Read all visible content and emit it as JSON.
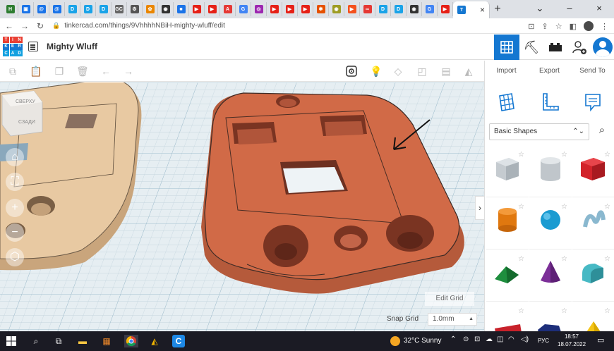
{
  "browser": {
    "tabs": [
      {
        "icon": "hp-icon",
        "color": "#2e7d32",
        "glyph": "H"
      },
      {
        "icon": "stats-icon",
        "color": "#1a73e8",
        "glyph": "▣"
      },
      {
        "icon": "at-icon",
        "color": "#1a73e8",
        "glyph": "@"
      },
      {
        "icon": "at-icon",
        "color": "#1a73e8",
        "glyph": "@"
      },
      {
        "icon": "docs-icon",
        "color": "#1aa3e8",
        "glyph": "D"
      },
      {
        "icon": "docs-icon",
        "color": "#1aa3e8",
        "glyph": "D"
      },
      {
        "icon": "docs-icon",
        "color": "#1aa3e8",
        "glyph": "D"
      },
      {
        "icon": "gc-icon",
        "color": "#666666",
        "glyph": "GC"
      },
      {
        "icon": "gear-icon",
        "color": "#555555",
        "glyph": "⚙"
      },
      {
        "icon": "puzzle-icon",
        "color": "#ea8600",
        "glyph": "✿"
      },
      {
        "icon": "github-icon",
        "color": "#333333",
        "glyph": "◉"
      },
      {
        "icon": "bookmark-icon",
        "color": "#1a73e8",
        "glyph": "■"
      },
      {
        "icon": "youtube-icon",
        "color": "#e62117",
        "glyph": "▶"
      },
      {
        "icon": "youtube-icon",
        "color": "#e62117",
        "glyph": "▶"
      },
      {
        "icon": "a-icon",
        "color": "#e53935",
        "glyph": "A"
      },
      {
        "icon": "google-icon",
        "color": "#4285f4",
        "glyph": "G"
      },
      {
        "icon": "lens-icon",
        "color": "#9c27b0",
        "glyph": "◎"
      },
      {
        "icon": "youtube-icon",
        "color": "#e62117",
        "glyph": "▶"
      },
      {
        "icon": "youtube-icon",
        "color": "#e62117",
        "glyph": "▶"
      },
      {
        "icon": "youtube-icon",
        "color": "#e62117",
        "glyph": "▶"
      },
      {
        "icon": "flower-icon",
        "color": "#e65100",
        "glyph": "✾"
      },
      {
        "icon": "eye-icon",
        "color": "#9e9d24",
        "glyph": "◉"
      },
      {
        "icon": "slides-icon",
        "color": "#f4511e",
        "glyph": "▶"
      },
      {
        "icon": "link-icon",
        "color": "#e53935",
        "glyph": "∞"
      },
      {
        "icon": "docs-icon",
        "color": "#1aa3e8",
        "glyph": "D"
      },
      {
        "icon": "docs-icon",
        "color": "#1aa3e8",
        "glyph": "D"
      },
      {
        "icon": "github-icon",
        "color": "#333333",
        "glyph": "◉"
      },
      {
        "icon": "google-icon",
        "color": "#4285f4",
        "glyph": "G"
      },
      {
        "icon": "youtube-icon",
        "color": "#e62117",
        "glyph": "▶"
      }
    ],
    "active_tab_close": "×",
    "new_tab": "+",
    "window_controls": [
      "⌄",
      "–",
      "×"
    ],
    "url": "tinkercad.com/things/9VhhhhNBiH-mighty-wluff/edit"
  },
  "app": {
    "logo_letters": [
      "T",
      "I",
      "N",
      "K",
      "E",
      "R",
      "C",
      "A",
      "D"
    ],
    "logo_colors": [
      "#e93f33",
      "#e93f33",
      "#e93f33",
      "#1477d1",
      "#1477d1",
      "#1477d1",
      "#13a1e0",
      "#13a1e0",
      "#13a1e0"
    ],
    "design_name": "Mighty Wluff",
    "accent": "#1477d1"
  },
  "panel": {
    "actions": [
      "Import",
      "Export",
      "Send To"
    ],
    "category": "Basic Shapes"
  },
  "viewport": {
    "edit_grid": "Edit Grid",
    "snap_label": "Snap Grid",
    "snap_value": "1.0mm",
    "viewcube_top": "СВЕРХУ",
    "viewcube_front": "СЗАДИ"
  },
  "taskbar": {
    "weather": "32°C Sunny",
    "lang": "РУС",
    "time": "18:57",
    "date": "18.07.2022"
  }
}
